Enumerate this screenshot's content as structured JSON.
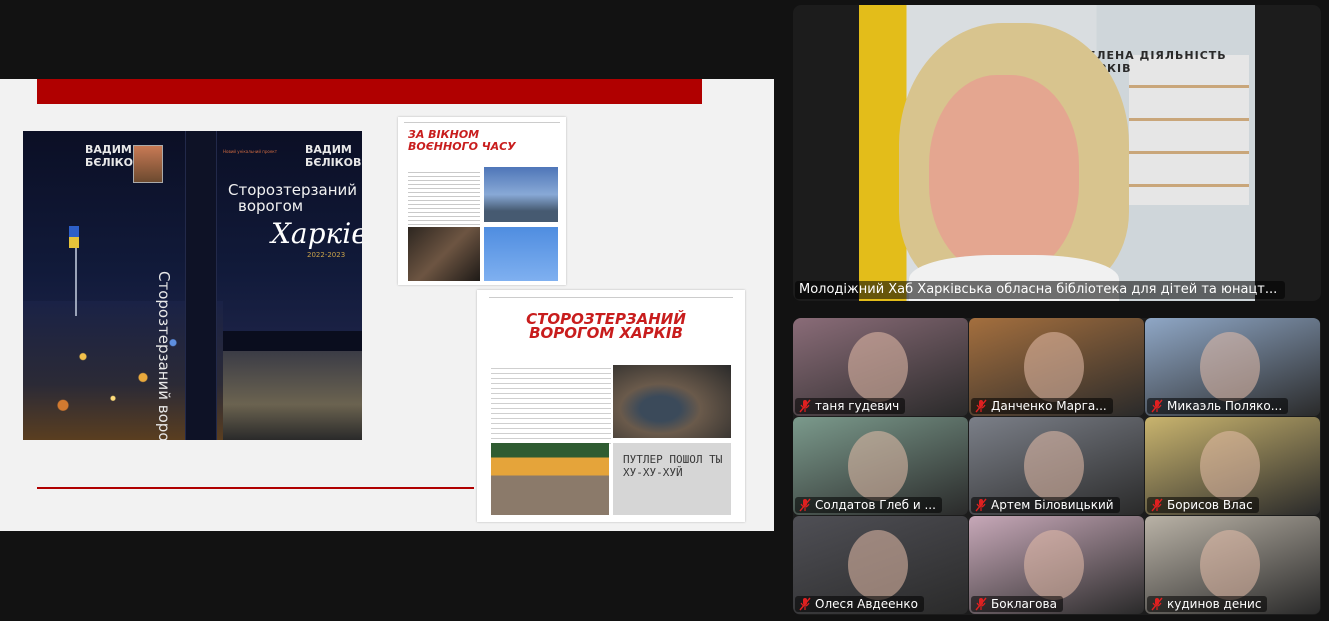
{
  "shared_screen": {
    "book": {
      "author": "ВАДИМ БЄЛІКОВ",
      "title_line1": "Сторозтерзаний",
      "title_line2": "ворогом",
      "title_city": "Харків",
      "years": "2022-2023",
      "spine": "Сторозтерзаний ворогом Харків",
      "tagline": "Новий унікальний проект"
    },
    "magazine_page1": {
      "title": "ЗА ВІКНОМ ВОЄННОГО ЧАСУ"
    },
    "magazine_page2": {
      "title": "СТОРОЗТЕРЗАНИЙ ВОРОГОМ ХАРКІВ",
      "graffiti": "ПУТЛЕР ПОШОЛ ТЫ ХУ-ХУ-ХУЙ"
    }
  },
  "main_speaker": {
    "name": "Молодіжний Хаб Харківська обласна бібліотека для дітей та юнацт...",
    "background_sign": "ЗЕЛЕНА ДІЯЛЬНІСТЬ ХАРКІВ"
  },
  "participants": [
    {
      "name": "таня гудевич",
      "muted": true,
      "bg": "#8a6c78"
    },
    {
      "name": "Данченко Марга...",
      "muted": true,
      "bg": "#a46f3e"
    },
    {
      "name": "Микаэль Поляко...",
      "muted": true,
      "bg": "#8fa7c6"
    },
    {
      "name": "Солдатов Глеб и ...",
      "muted": true,
      "bg": "#7b9a8c"
    },
    {
      "name": "Артем Біловицький",
      "muted": true,
      "bg": "#7b7f88"
    },
    {
      "name": "Борисов Влас",
      "muted": true,
      "bg": "#c9b46e"
    },
    {
      "name": "Олеся Авдеенко",
      "muted": true,
      "bg": "#4f4f55"
    },
    {
      "name": "Боклагова",
      "muted": true,
      "bg": "#c7a8b8"
    },
    {
      "name": "кудинов денис",
      "muted": true,
      "bg": "#b9b2a6"
    }
  ],
  "colors": {
    "accent_red": "#b00000",
    "mute_red": "#e02020",
    "app_bg": "#121212"
  }
}
